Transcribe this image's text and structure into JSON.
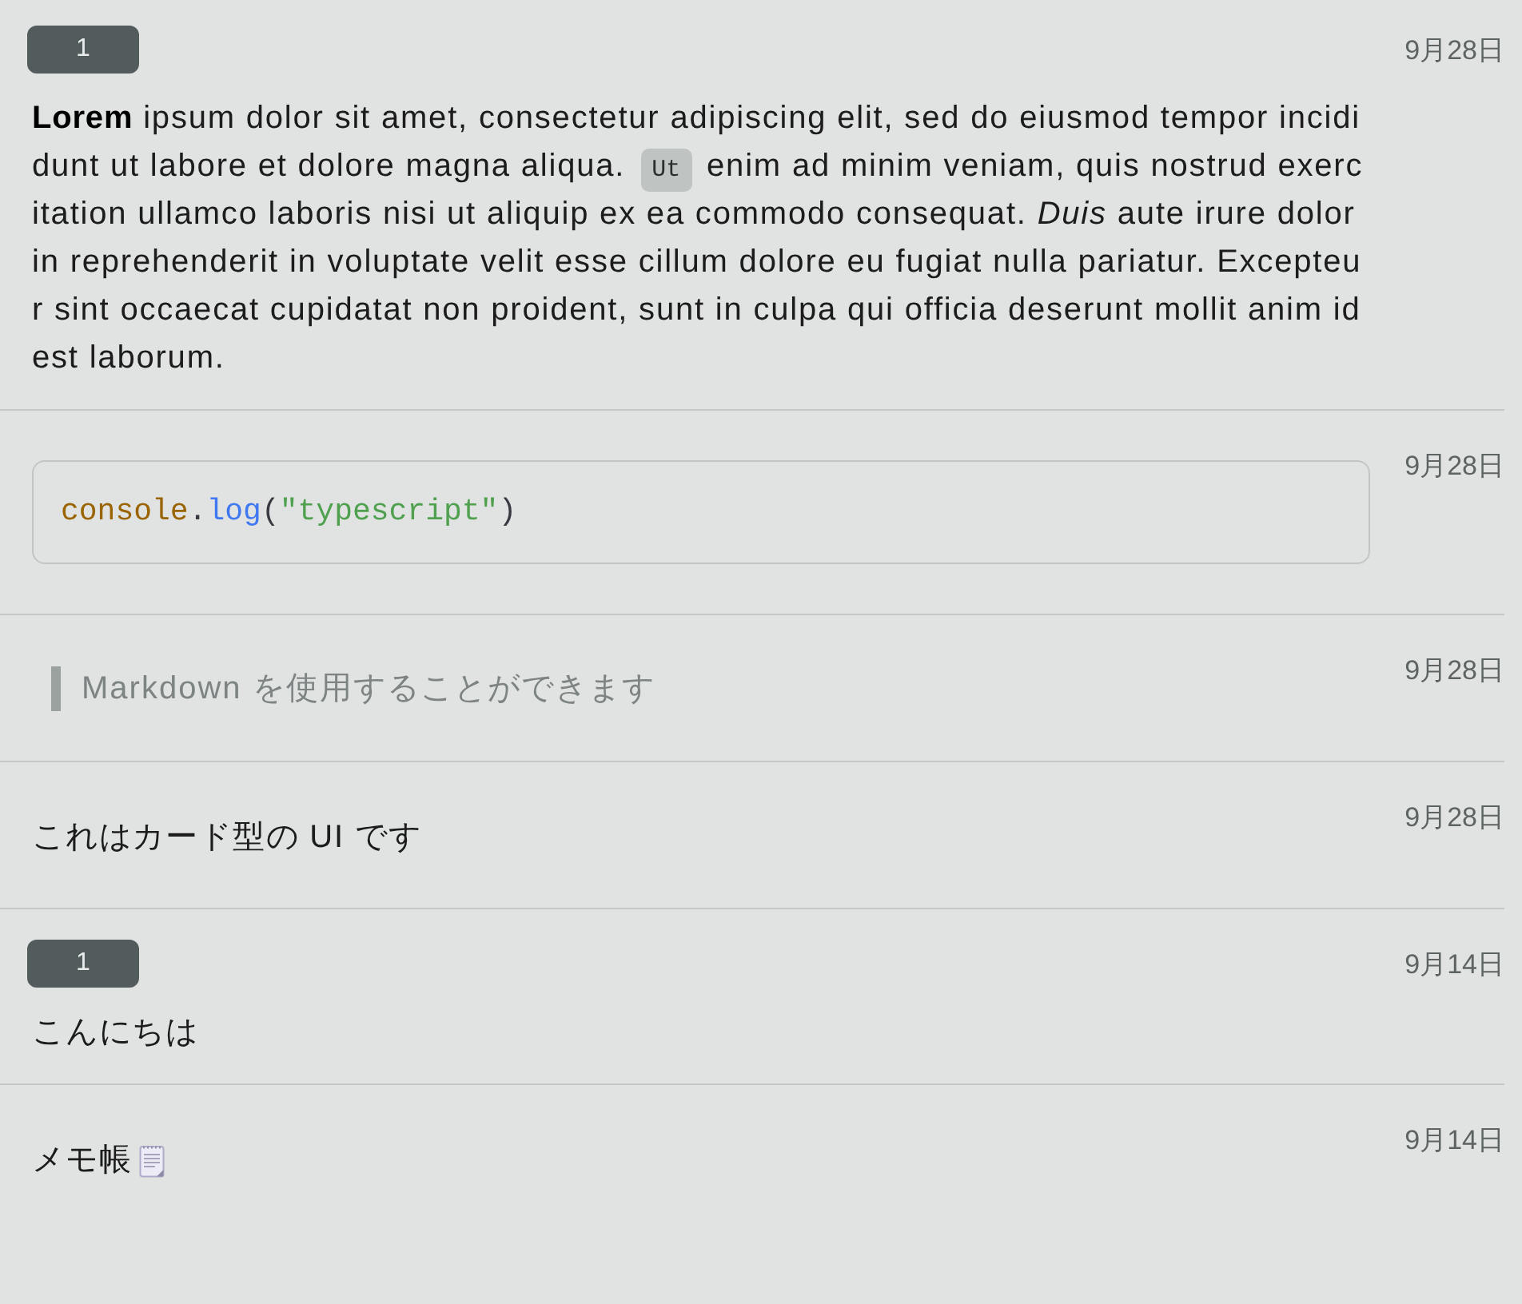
{
  "memos": [
    {
      "badge": "1",
      "date": "9月28日",
      "blocks": [
        {
          "kind": "paragraph",
          "segments": [
            {
              "kind": "text",
              "text": "**Lorem** ipsum dolor sit amet, consectetur adipiscing elit, sed do eiusmod tempor incididunt ut labore et dolore magna aliqua. "
            },
            {
              "kind": "code",
              "text": "Ut"
            },
            {
              "kind": "text",
              "text": " enim ad minim veniam, quis nostrud exercitation ullamco laboris nisi ut aliquip ex ea commodo consequat. *Duis* aute irure dolor in reprehenderit in voluptate velit esse cillum dolore eu fugiat nulla pariatur. Excepteur sint occaecat cupidatat non proident, sunt in culpa qui officia deserunt mollit anim id est laborum."
            }
          ]
        }
      ]
    },
    {
      "date": "9月28日",
      "blocks": [
        {
          "kind": "code_block",
          "tokens": [
            {
              "kind": "variable",
              "text": "console"
            },
            {
              "kind": "punctuation",
              "text": "."
            },
            {
              "kind": "function",
              "text": "log"
            },
            {
              "kind": "punctuation",
              "text": "("
            },
            {
              "kind": "string",
              "text": "\"typescript\""
            },
            {
              "kind": "punctuation",
              "text": ")"
            }
          ]
        }
      ]
    },
    {
      "date": "9月28日",
      "blocks": [
        {
          "kind": "quote",
          "text": "Markdown を使用することができます"
        }
      ]
    },
    {
      "date": "9月28日",
      "blocks": [
        {
          "kind": "paragraph",
          "segments": [
            {
              "kind": "text",
              "text": "これはカード型の UI です"
            }
          ]
        }
      ]
    },
    {
      "badge": "1",
      "date": "9月14日",
      "blocks": [
        {
          "kind": "paragraph",
          "segments": [
            {
              "kind": "text",
              "text": "こんにちは"
            }
          ]
        }
      ]
    },
    {
      "date": "9月14日",
      "blocks": [
        {
          "kind": "paragraph",
          "segments": [
            {
              "kind": "text",
              "text": "メモ帳"
            },
            {
              "kind": "icon"
            }
          ]
        }
      ]
    }
  ]
}
